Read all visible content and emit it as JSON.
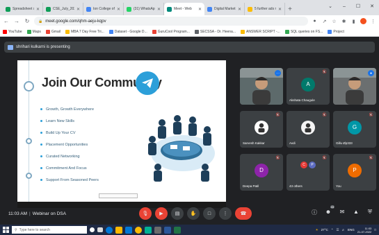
{
  "browser": {
    "tabs": [
      {
        "label": "Spreadsheet shi",
        "fav_color": "#0f9d58",
        "active": false
      },
      {
        "label": "CSE_July_2022",
        "fav_color": "#0f9d58",
        "active": false
      },
      {
        "label": "Ion College of",
        "fav_color": "#4285f4",
        "active": false
      },
      {
        "label": "(31) WhatsApp",
        "fav_color": "#25d366",
        "active": false
      },
      {
        "label": "Meet - Web",
        "fav_color": "#00897b",
        "active": true
      },
      {
        "label": "Digital Marketin",
        "fav_color": "#4285f4",
        "active": false
      },
      {
        "label": "5 further ads mon",
        "fav_color": "#fbbc04",
        "active": false
      }
    ],
    "url": "meet.google.com/qhm-aeju-kqpv",
    "bookmarks": [
      {
        "label": "YouTube",
        "color": "#ff0000"
      },
      {
        "label": "Maps",
        "color": "#34a853"
      },
      {
        "label": "Gmail",
        "color": "#ea4335"
      },
      {
        "label": "MBA 7 Day Free Tri...",
        "color": "#fbbc04"
      },
      {
        "label": "Dataset - Google D...",
        "color": "#4285f4"
      },
      {
        "label": "GuruCool Program...",
        "color": "#ea4335"
      },
      {
        "label": "SECSSA - Dr. Heena...",
        "color": "#5f6368"
      },
      {
        "label": "ANSWER SCRIPT -...",
        "color": "#fbbc04"
      },
      {
        "label": "SQL queries on FS...",
        "color": "#34a853"
      },
      {
        "label": "Project",
        "color": "#4285f4"
      }
    ]
  },
  "meet": {
    "presenting_text": "shrihari kulkarni is presenting",
    "slide": {
      "title": "Join Our Community",
      "bullets": [
        "Growth, Growth Everywhere",
        "Learn New Skills",
        "Build Up Your CV",
        "Placement Opportunities",
        "Curated Networking",
        "Commitment And Focus",
        "Support From Seasoned Peers"
      ]
    },
    "participants": [
      {
        "name": "",
        "kind": "photo",
        "color": "#5d6a6b"
      },
      {
        "name": "Akshata Chaugule",
        "initial": "A",
        "color": "#00796b"
      },
      {
        "name": "",
        "kind": "photo",
        "color": "#6b6f70"
      },
      {
        "name": "Sarvesh Kakkar",
        "kind": "icon",
        "color": "#ffffff"
      },
      {
        "name": "Avdi",
        "kind": "icon",
        "color": "#f4f4f4"
      },
      {
        "name": "Gillu Øp333",
        "initial": "G",
        "color": "#0097a7"
      },
      {
        "name": "Deepa Patil",
        "initial": "D",
        "color": "#8e24aa"
      },
      {
        "name": "43 others",
        "kind": "others"
      },
      {
        "name": "You",
        "initial": "P",
        "color": "#ef6c00"
      }
    ],
    "others_avatars": [
      {
        "initial": "C",
        "color": "#e53935"
      },
      {
        "initial": "P",
        "color": "#5c6bc0"
      }
    ],
    "meeting_time": "11:03 AM",
    "meeting_title": "Webinar on DSA",
    "participant_count": "43"
  },
  "taskbar": {
    "search_placeholder": "Type here to search",
    "temperature": "27°C",
    "lang": "ENG",
    "time": "11:03",
    "date": "21-07-2022"
  }
}
